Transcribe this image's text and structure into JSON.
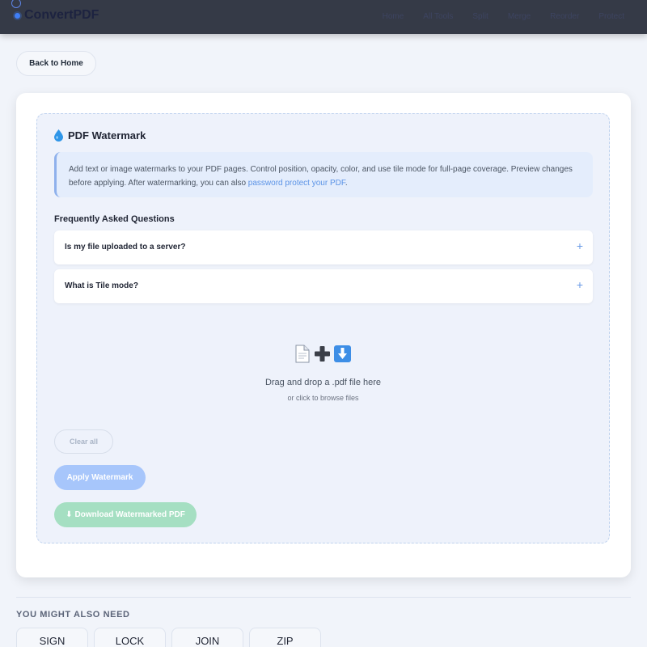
{
  "header": {
    "brand": "ConvertPDF",
    "nav": [
      "Home",
      "All Tools",
      "Split",
      "Merge",
      "Reorder",
      "Protect"
    ]
  },
  "back_button": "Back to Home",
  "tool": {
    "title": "PDF Watermark",
    "title_icon": "droplet-icon",
    "description": "Add text or image watermarks to your PDF pages. Control position, opacity, color, and use tile mode for full-page coverage. Preview changes before applying. After watermarking, you can also ",
    "description_link": "password protect your PDF",
    "description_end": "."
  },
  "faq": {
    "heading": "Frequently Asked Questions",
    "items": [
      {
        "question": "Is my file uploaded to a server?",
        "toggle": "+"
      },
      {
        "question": "What is Tile mode?",
        "toggle": "+"
      }
    ]
  },
  "upload": {
    "icons": [
      "document-icon",
      "plus-icon",
      "download-arrow-icon"
    ],
    "drag_text": "Drag and drop a .pdf file here",
    "browse_text": "or click to browse files"
  },
  "actions": {
    "clear": "Clear all",
    "apply": "Apply Watermark",
    "download_icon": "⬇",
    "download": "Download Watermarked PDF"
  },
  "related": {
    "heading": "YOU MIGHT ALSO NEED",
    "items": [
      "SIGN",
      "LOCK",
      "JOIN",
      "ZIP"
    ]
  },
  "colors": {
    "header_bg": "#353a47",
    "accent": "#3f7ef7",
    "apply_button": "#a7c6fb",
    "download_button": "#a5dfc2",
    "info_box": "#e4edfc"
  }
}
